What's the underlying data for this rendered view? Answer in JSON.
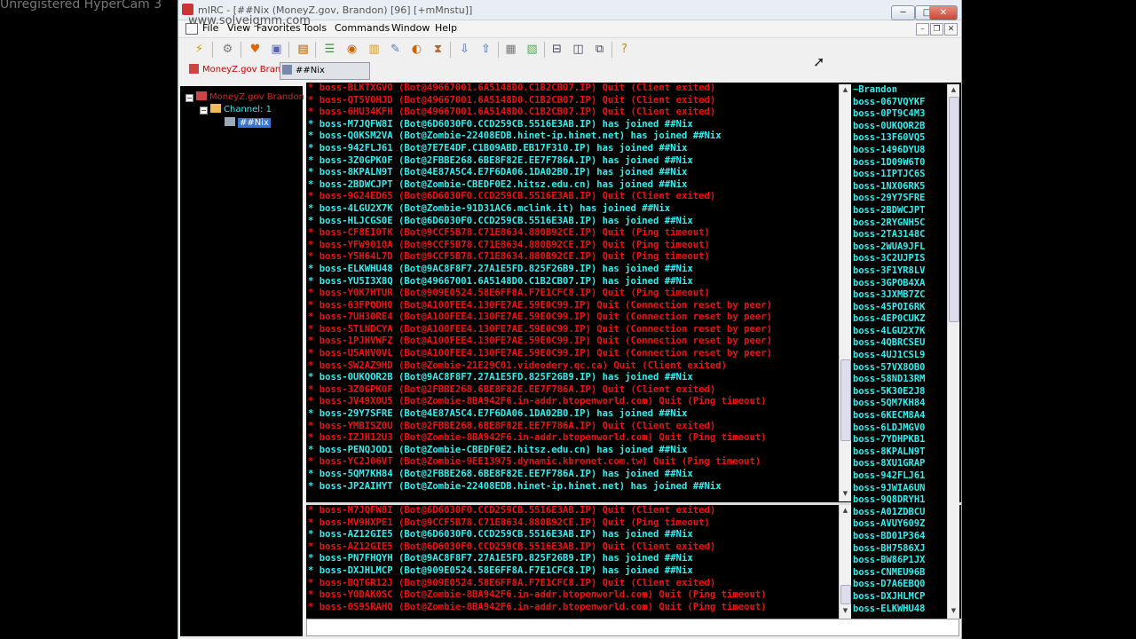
{
  "watermark": {
    "line1": "Unregistered HyperCam 3",
    "line2": "www.solveigmm.com"
  },
  "window": {
    "title": "mIRC - [##Nix (MoneyZ.gov, Brandon) [96] [+mMnstu]]"
  },
  "title_buttons": {
    "minimize": "─",
    "maximize": "□",
    "close": "✕"
  },
  "mdi_buttons": {
    "minimize": "–",
    "restore": "❐",
    "close": "✕"
  },
  "menu": {
    "items": [
      "File",
      "View",
      "Favorites",
      "Tools",
      "Commands",
      "Window",
      "Help"
    ]
  },
  "toolbar": {
    "icons": [
      "connect-icon",
      "options-icon",
      "favorites-icon",
      "chat-icon",
      "address-book-icon",
      "channels-list-icon",
      "dcc-icon",
      "notify-icon",
      "scripts-icon",
      "colors-icon",
      "timer-icon",
      "received-icon",
      "send-icon",
      "log-icon",
      "tile-icon",
      "cascade-icon",
      "arrange-icon",
      "help-icon"
    ]
  },
  "window_tabs": [
    {
      "label": "MoneyZ.gov Bran..."
    },
    {
      "label": "##Nix"
    }
  ],
  "tree": {
    "server": "MoneyZ.gov Brandon",
    "folder": "Channel: 1",
    "channel": "##Nix"
  },
  "chat_lines": [
    {
      "c": "red",
      "t": "* boss-BLKTXGVO (Bot@49667001.6A5148D0.C1B2CB07.IP) Quit (Client exited)"
    },
    {
      "c": "red",
      "t": "* boss-QT5V0HJD (Bot@49667001.6A5148D0.C1B2CB07.IP) Quit (Client exited)"
    },
    {
      "c": "red",
      "t": "* boss-6HU34KFH (Bot@49667001.6A5148D0.C1B2CB07.IP) Quit (Client exited)"
    },
    {
      "c": "cyan",
      "t": "* boss-M7JQFW8I (Bot@6D6030F0.CCD259CB.5516E3AB.IP) has joined ##Nix"
    },
    {
      "c": "cyan",
      "t": "* boss-Q0KSM2VA (Bot@Zombie-22408EDB.hinet-ip.hinet.net) has joined ##Nix"
    },
    {
      "c": "cyan",
      "t": "* boss-942FLJ61 (Bot@7E7E4DF.C1B09ABD.EB17F310.IP) has joined ##Nix"
    },
    {
      "c": "cyan",
      "t": "* boss-3Z0GPK0F (Bot@2FBBE268.6BE8F82E.EE7F786A.IP) has joined ##Nix"
    },
    {
      "c": "cyan",
      "t": "* boss-8KPALN9T (Bot@4E87A5C4.E7F6DA06.1DA02B0.IP) has joined ##Nix"
    },
    {
      "c": "cyan",
      "t": "* boss-2BDWCJPT (Bot@Zombie-CBEDF0E2.hitsz.edu.cn) has joined ##Nix"
    },
    {
      "c": "red",
      "t": "* boss-9G24ED65 (Bot@6D6030F0.CCD259CB.5516E3AB.IP) Quit (Client exited)"
    },
    {
      "c": "cyan",
      "t": "* boss-4LGU2X7K (Bot@Zombie-91D31AC6.mclink.it) has joined ##Nix"
    },
    {
      "c": "cyan",
      "t": "* boss-HLJCGS0E (Bot@6D6030F0.CCD259CB.5516E3AB.IP) has joined ##Nix"
    },
    {
      "c": "red",
      "t": "* boss-CF8EI0TK (Bot@9CCF5B78.C71E8634.880B92CE.IP) Quit (Ping timeout)"
    },
    {
      "c": "red",
      "t": "* boss-YFW9010A (Bot@9CCF5B78.C71E8634.880B92CE.IP) Quit (Ping timeout)"
    },
    {
      "c": "red",
      "t": "* boss-Y5H64L7D (Bot@9CCF5B78.C71E8634.880B92CE.IP) Quit (Ping timeout)"
    },
    {
      "c": "cyan",
      "t": "* boss-ELKWHU48 (Bot@9AC8F8F7.27A1E5FD.825F26B9.IP) has joined ##Nix"
    },
    {
      "c": "cyan",
      "t": "* boss-YU5I3X8Q (Bot@49667001.6A5148D0.C1B2CB07.IP) has joined ##Nix"
    },
    {
      "c": "red",
      "t": "* boss-Y0K7HTUR (Bot@909E0524.58E6FF8A.F7E1CFC8.IP) Quit (Ping timeout)"
    },
    {
      "c": "red",
      "t": "* boss-63FPQDH0 (Bot@A100FEE4.130FE7AE.59E0C99.IP) Quit (Connection reset by peer)"
    },
    {
      "c": "red",
      "t": "* boss-7UH30RE4 (Bot@A100FEE4.130FE7AE.59E0C99.IP) Quit (Connection reset by peer)"
    },
    {
      "c": "red",
      "t": "* boss-5TLNDCYA (Bot@A100FEE4.130FE7AE.59E0C99.IP) Quit (Connection reset by peer)"
    },
    {
      "c": "red",
      "t": "* boss-1PJHVWFZ (Bot@A100FEE4.130FE7AE.59E0C99.IP) Quit (Connection reset by peer)"
    },
    {
      "c": "red",
      "t": "* boss-U5AHV0VL (Bot@A100FEE4.130FE7AE.59E0C99.IP) Quit (Connection reset by peer)"
    },
    {
      "c": "red",
      "t": "* boss-SW2AZ9HD (Bot@Zombie-21E29C01.videodery.qc.ca) Quit (Client exited)"
    },
    {
      "c": "cyan",
      "t": "* boss-0UKQOR2B (Bot@9AC8F8F7.27A1E5FD.825F26B9.IP) has joined ##Nix"
    },
    {
      "c": "red",
      "t": "* boss-3Z0GPK0F (Bot@2FBBE268.6BE8F82E.EE7F786A.IP) Quit (Client exited)"
    },
    {
      "c": "red",
      "t": "* boss-JV49X0U5 (Bot@Zombie-8BA942F6.in-addr.btopenworld.com) Quit (Ping timeout)"
    },
    {
      "c": "cyan",
      "t": "* boss-29Y7SFRE (Bot@4E87A5C4.E7F6DA06.1DA02B0.IP) has joined ##Nix"
    },
    {
      "c": "red",
      "t": "* boss-YMBISZ0U (Bot@2FBBE268.6BE8F82E.EE7F786A.IP) Quit (Client exited)"
    },
    {
      "c": "red",
      "t": "* boss-IZJH12U3 (Bot@Zombie-8BA942F6.in-addr.btopenworld.com) Quit (Ping timeout)"
    },
    {
      "c": "cyan",
      "t": "* boss-PENQJOD1 (Bot@Zombie-CBEDF0E2.hitsz.edu.cn) has joined ##Nix"
    },
    {
      "c": "red",
      "t": "* boss-YC2J06VT (Bot@Zombie-9EE13975.dynamic.kbronet.com.tw) Quit (Ping timeout)"
    },
    {
      "c": "cyan",
      "t": "* boss-5QM7KH84 (Bot@2FBBE268.6BE8F82E.EE7F786A.IP) has joined ##Nix"
    },
    {
      "c": "cyan",
      "t": "* boss-JP2AIHYT (Bot@Zombie-22408EDB.hinet-ip.hinet.net) has joined ##Nix"
    }
  ],
  "chat_lines_lower": [
    {
      "c": "red",
      "t": "* boss-M7JQFW8I (Bot@6D6030F0.CCD259CB.5516E3AB.IP) Quit (Client exited)"
    },
    {
      "c": "red",
      "t": "* boss-MV9HXPE1 (Bot@9CCF5B78.C71E8634.880B92CE.IP) Quit (Ping timeout)"
    },
    {
      "c": "cyan",
      "t": "* boss-AZ12GIE5 (Bot@6D6030F0.CCD259CB.5516E3AB.IP) has joined ##Nix"
    },
    {
      "c": "red",
      "t": "* boss-AZ12GIE5 (Bot@6D6030F0.CCD259CB.5516E3AB.IP) Quit (Client exited)"
    },
    {
      "c": "cyan",
      "t": "* boss-PN7FHQYH (Bot@9AC8F8F7.27A1E5FD.825F26B9.IP) has joined ##Nix"
    },
    {
      "c": "cyan",
      "t": "* boss-DXJHLMCP (Bot@909E0524.58E6FF8A.F7E1CFC8.IP) has joined ##Nix"
    },
    {
      "c": "red",
      "t": "* boss-BQTGR12J (Bot@909E0524.58E6FF8A.F7E1CFC8.IP) Quit (Client exited)"
    },
    {
      "c": "red",
      "t": "* boss-Y0DAK0SC (Bot@Zombie-8BA942F6.in-addr.btopenworld.com) Quit (Ping timeout)"
    },
    {
      "c": "red",
      "t": "* boss-0S9SRAHQ (Bot@Zombie-8BA942F6.in-addr.btopenworld.com) Quit (Ping timeout)"
    }
  ],
  "nicklist": [
    "~Brandon",
    "boss-067VQYKF",
    "boss-0PT9C4M3",
    "boss-0UKQOR2B",
    "boss-13F60VQ5",
    "boss-1496DYU8",
    "boss-1D09W6T0",
    "boss-1IPTJC6S",
    "boss-1NX06RK5",
    "boss-29Y7SFRE",
    "boss-2BDWCJPT",
    "boss-2RYGNH5C",
    "boss-2TA3148C",
    "boss-2WUA9JFL",
    "boss-3C2UJPIS",
    "boss-3F1YR8LV",
    "boss-3GPOB4XA",
    "boss-3JXMB7ZC",
    "boss-45POI6RK",
    "boss-4EP0CUKZ",
    "boss-4LGU2X7K",
    "boss-4QBRCSEU",
    "boss-4UJ1CSL9",
    "boss-57VX8OB0",
    "boss-58ND13RM",
    "boss-5K30E2J8",
    "boss-5QM7KH84",
    "boss-6KECM8A4",
    "boss-6LDJMGV0",
    "boss-7YDHPKB1",
    "boss-8KPALN9T",
    "boss-8XU1GRAP",
    "boss-942FLJ61",
    "boss-9JWIA6UN",
    "boss-9Q8DRYH1",
    "boss-A01ZDBCU",
    "boss-AVUY609Z",
    "boss-BD01P364",
    "boss-BH7586XJ",
    "boss-BW86P1JX",
    "boss-CNMEU96B",
    "boss-D7A6EBQ0",
    "boss-DXJHLMCP",
    "boss-ELKWHU48"
  ],
  "colors": {
    "quit": "#ee1111",
    "join": "#33eeee",
    "selection": "#3375d6"
  }
}
